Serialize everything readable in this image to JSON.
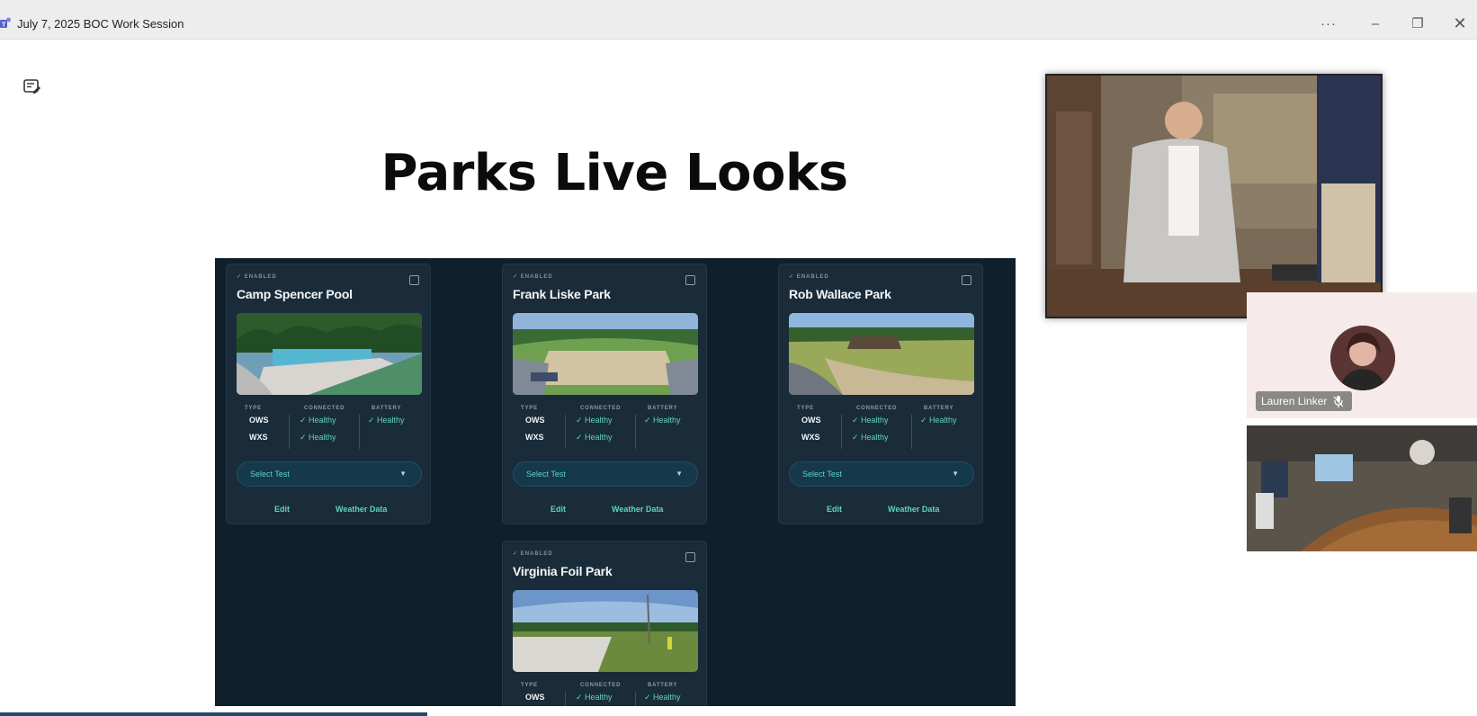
{
  "window": {
    "title": "July 7, 2025 BOC Work Session",
    "more_label": "···",
    "min_label": "–",
    "restore_label": "❐",
    "close_label": "✕"
  },
  "slide": {
    "title": "Parks Live Looks",
    "cards": [
      {
        "status": "✓ ENABLED",
        "name": "Camp Spencer Pool",
        "headers": {
          "type": "TYPE",
          "connected": "CONNECTED",
          "battery": "BATTERY"
        },
        "rows": [
          {
            "type": "OWS",
            "connected": "✓ Healthy",
            "battery": "✓ Healthy"
          },
          {
            "type": "WXS",
            "connected": "✓ Healthy",
            "battery": ""
          }
        ],
        "select": "Select Test",
        "edit": "Edit",
        "weather": "Weather Data"
      },
      {
        "status": "✓ ENABLED",
        "name": "Frank Liske Park",
        "headers": {
          "type": "TYPE",
          "connected": "CONNECTED",
          "battery": "BATTERY"
        },
        "rows": [
          {
            "type": "OWS",
            "connected": "✓ Healthy",
            "battery": "✓ Healthy"
          },
          {
            "type": "WXS",
            "connected": "✓ Healthy",
            "battery": ""
          }
        ],
        "select": "Select Test",
        "edit": "Edit",
        "weather": "Weather Data"
      },
      {
        "status": "✓ ENABLED",
        "name": "Rob Wallace Park",
        "headers": {
          "type": "TYPE",
          "connected": "CONNECTED",
          "battery": "BATTERY"
        },
        "rows": [
          {
            "type": "OWS",
            "connected": "✓ Healthy",
            "battery": "✓ Healthy"
          },
          {
            "type": "WXS",
            "connected": "✓ Healthy",
            "battery": ""
          }
        ],
        "select": "Select Test",
        "edit": "Edit",
        "weather": "Weather Data"
      },
      {
        "status": "✓ ENABLED",
        "name": "Virginia Foil Park",
        "headers": {
          "type": "TYPE",
          "connected": "CONNECTED",
          "battery": "BATTERY"
        },
        "rows": [
          {
            "type": "OWS",
            "connected": "✓ Healthy",
            "battery": "✓ Healthy"
          }
        ]
      }
    ]
  },
  "participants": {
    "lauren": {
      "name": "Lauren Linker"
    }
  },
  "icons": {
    "app": "teams-icon",
    "notes": "notes-icon",
    "mic": "mic-off-icon"
  },
  "colors": {
    "dashboard_bg": "#0f1f2b",
    "card_bg": "#1a2c3a",
    "accent_teal": "#5fd3c1"
  }
}
